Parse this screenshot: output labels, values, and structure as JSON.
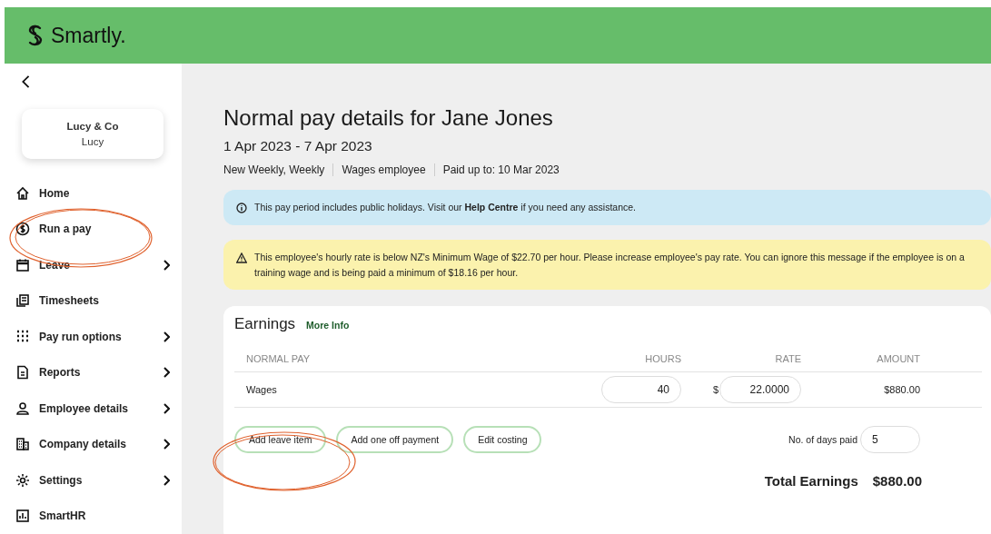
{
  "header": {
    "logo": "Smartly."
  },
  "sidebar": {
    "company": {
      "name": "Lucy & Co",
      "user": "Lucy"
    },
    "items": [
      {
        "label": "Home",
        "expandable": false
      },
      {
        "label": "Run a pay",
        "expandable": false
      },
      {
        "label": "Leave",
        "expandable": true
      },
      {
        "label": "Timesheets",
        "expandable": false
      },
      {
        "label": "Pay run options",
        "expandable": true
      },
      {
        "label": "Reports",
        "expandable": true
      },
      {
        "label": "Employee details",
        "expandable": true
      },
      {
        "label": "Company details",
        "expandable": true
      },
      {
        "label": "Settings",
        "expandable": true
      },
      {
        "label": "SmartHR",
        "expandable": false
      }
    ]
  },
  "page": {
    "title": "Normal pay details for Jane Jones",
    "period": "1 Apr 2023 - 7 Apr 2023",
    "meta": [
      "New Weekly, Weekly",
      "Wages employee",
      "Paid up to: 10 Mar 2023"
    ],
    "alerts": [
      {
        "kind": "info",
        "text": "This pay period includes public holidays. Visit our **Help Centre** if you need any assistance."
      },
      {
        "kind": "warning",
        "text": "This employee's hourly rate is below NZ's Minimum Wage of $22.70 per hour. Please increase employee's pay rate. You can ignore this message if the employee is on a training wage and is being paid a minimum of $18.16 per hour."
      }
    ],
    "earnings": {
      "title": "Earnings",
      "link": "More Info",
      "columns": [
        "NORMAL PAY",
        "HOURS",
        "RATE",
        "AMOUNT"
      ],
      "rows": [
        {
          "name": "Wages",
          "hours": "40",
          "currency": "$",
          "rate": "22.0000",
          "amount": "$880.00"
        }
      ],
      "buttons": [
        "Add leave item",
        "Add one off payment",
        "Edit costing"
      ],
      "days_label": "No. of days paid",
      "days_value": "5",
      "total_label": "Total Earnings",
      "total_value": "$880.00"
    }
  }
}
